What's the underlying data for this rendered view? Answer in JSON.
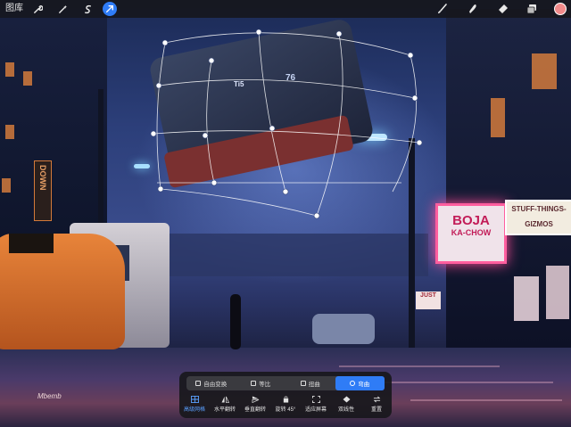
{
  "toolbar": {
    "gallery_label": "图库",
    "left_tools": [
      {
        "name": "actions",
        "icon": "wrench-icon"
      },
      {
        "name": "adjustments",
        "icon": "magic-wand-icon"
      },
      {
        "name": "selection",
        "icon": "selection-s-icon"
      },
      {
        "name": "transform",
        "icon": "transform-arrow-icon",
        "active": true
      }
    ],
    "right_tools": [
      {
        "name": "brush",
        "icon": "brush-icon"
      },
      {
        "name": "smudge",
        "icon": "smudge-icon"
      },
      {
        "name": "eraser",
        "icon": "eraser-icon"
      },
      {
        "name": "layers",
        "icon": "layers-icon"
      },
      {
        "name": "color",
        "icon": "color-swatch"
      }
    ],
    "accent_color": "#2f7cf6",
    "current_color": "#f08a8a"
  },
  "artwork": {
    "signs": {
      "boja_line1": "BOJA",
      "boja_line2": "KA-CHOW",
      "stuff": "STUFF-THINGS-GIZMOS",
      "down": "DOWN",
      "just": "JUST",
      "truck_number": "76",
      "truck_brand": "Ti5",
      "signature": "Mbemb"
    }
  },
  "transform_panel": {
    "modes": [
      {
        "label": "自由变换",
        "icon": "free-transform-icon",
        "active": false
      },
      {
        "label": "等比",
        "icon": "uniform-icon",
        "active": false
      },
      {
        "label": "扭曲",
        "icon": "distort-icon",
        "active": false
      },
      {
        "label": "弯曲",
        "icon": "warp-icon",
        "active": true
      }
    ],
    "actions": [
      {
        "label": "高级网格",
        "icon": "advanced-mesh-icon",
        "active": true
      },
      {
        "label": "水平翻转",
        "icon": "flip-horizontal-icon",
        "active": false
      },
      {
        "label": "垂直翻转",
        "icon": "flip-vertical-icon",
        "active": false
      },
      {
        "label": "旋转 45°",
        "icon": "rotate-icon",
        "active": false
      },
      {
        "label": "适应屏幕",
        "icon": "fit-screen-icon",
        "active": false
      },
      {
        "label": "双线性",
        "icon": "bilinear-icon",
        "active": false
      },
      {
        "label": "重置",
        "icon": "reset-icon",
        "active": false
      }
    ]
  }
}
